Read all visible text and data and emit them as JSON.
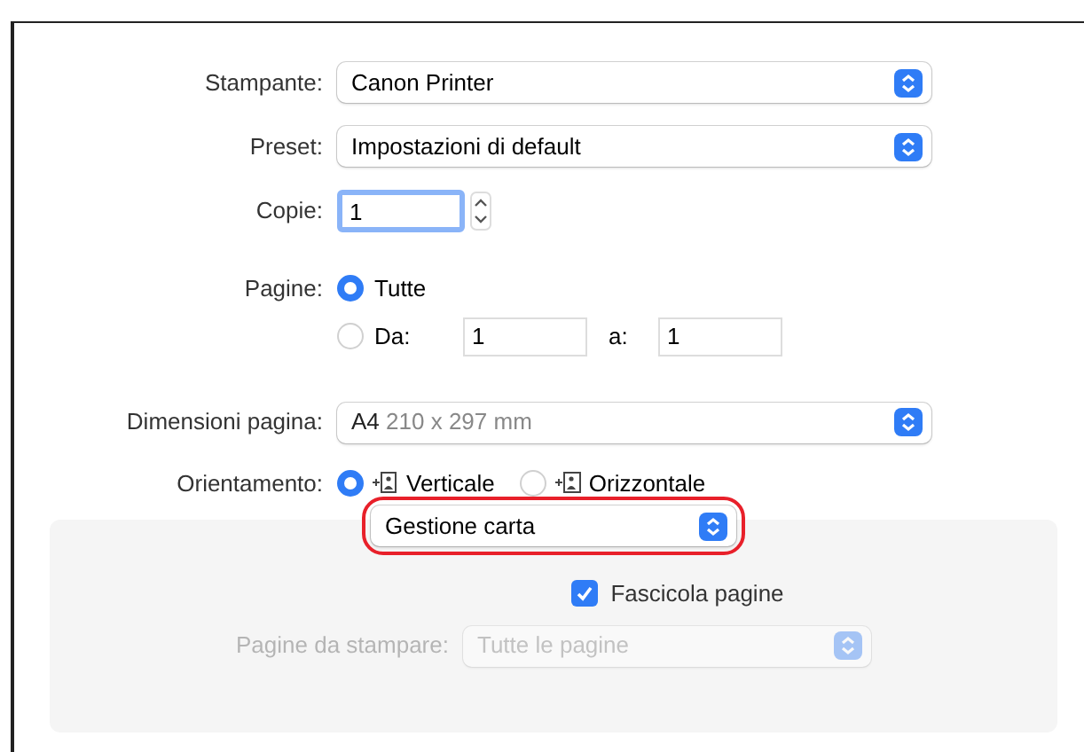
{
  "printer": {
    "label": "Stampante:",
    "value": "Canon Printer"
  },
  "preset": {
    "label": "Preset:",
    "value": "Impostazioni di default"
  },
  "copies": {
    "label": "Copie:",
    "value": "1"
  },
  "pages": {
    "label": "Pagine:",
    "options": [
      {
        "kind": "all",
        "label": "Tutte",
        "selected": true
      },
      {
        "kind": "range",
        "label": "Da:",
        "selected": false,
        "from": "1",
        "to_label": "a:",
        "to": "1"
      }
    ]
  },
  "paper_size": {
    "label": "Dimensioni pagina:",
    "name": "A4",
    "size": "210 x 297 mm"
  },
  "orientation": {
    "label": "Orientamento:",
    "options": [
      {
        "kind": "portrait",
        "label": "Verticale",
        "selected": true
      },
      {
        "kind": "landscape",
        "label": "Orizzontale",
        "selected": false
      }
    ]
  },
  "section": {
    "value": "Gestione carta",
    "highlighted": true
  },
  "collate": {
    "label": "Fascicola pagine",
    "checked": true
  },
  "pages_to_print": {
    "label": "Pagine da stampare:",
    "value": "Tutte le pagine"
  }
}
